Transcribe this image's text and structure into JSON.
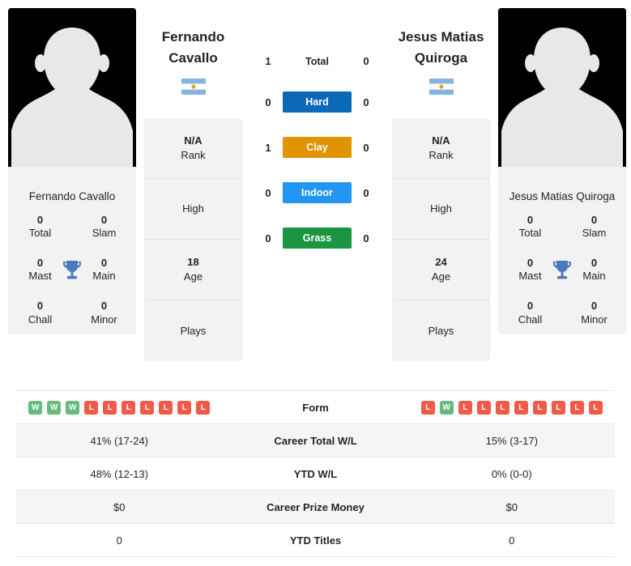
{
  "players": {
    "left": {
      "display_name_line1": "Fernando",
      "display_name_line2": "Cavallo",
      "full_name": "Fernando Cavallo",
      "flag": "argentina-flag",
      "avatar": "player-silhouette",
      "rank_value": "N/A",
      "rank_label": "Rank",
      "high_value": "",
      "high_label": "High",
      "age_value": "18",
      "age_label": "Age",
      "plays_value": "",
      "plays_label": "Plays",
      "titles": [
        {
          "value": "0",
          "label": "Total"
        },
        {
          "value": "0",
          "label": "Slam"
        },
        {
          "value": "0",
          "label": "Mast"
        },
        {
          "value": "0",
          "label": "Main"
        },
        {
          "value": "0",
          "label": "Chall"
        },
        {
          "value": "0",
          "label": "Minor"
        }
      ],
      "form": [
        "W",
        "W",
        "W",
        "L",
        "L",
        "L",
        "L",
        "L",
        "L",
        "L"
      ],
      "career_total_wl": "41% (17-24)",
      "ytd_wl": "48% (12-13)",
      "career_prize_money": "$0",
      "ytd_titles": "0"
    },
    "right": {
      "display_name_line1": "Jesus Matias",
      "display_name_line2": "Quiroga",
      "full_name": "Jesus Matias Quiroga",
      "flag": "argentina-flag",
      "avatar": "player-silhouette",
      "rank_value": "N/A",
      "rank_label": "Rank",
      "high_value": "",
      "high_label": "High",
      "age_value": "24",
      "age_label": "Age",
      "plays_value": "",
      "plays_label": "Plays",
      "titles": [
        {
          "value": "0",
          "label": "Total"
        },
        {
          "value": "0",
          "label": "Slam"
        },
        {
          "value": "0",
          "label": "Mast"
        },
        {
          "value": "0",
          "label": "Main"
        },
        {
          "value": "0",
          "label": "Chall"
        },
        {
          "value": "0",
          "label": "Minor"
        }
      ],
      "form": [
        "L",
        "W",
        "L",
        "L",
        "L",
        "L",
        "L",
        "L",
        "L",
        "L"
      ],
      "career_total_wl": "15% (3-17)",
      "ytd_wl": "0% (0-0)",
      "career_prize_money": "$0",
      "ytd_titles": "0"
    }
  },
  "head_to_head": [
    {
      "left": "1",
      "label": "Total",
      "right": "0",
      "style": "plain",
      "color": ""
    },
    {
      "left": "0",
      "label": "Hard",
      "right": "0",
      "style": "bar",
      "color": "#0b69b8"
    },
    {
      "left": "1",
      "label": "Clay",
      "right": "0",
      "style": "bar",
      "color": "#e09400"
    },
    {
      "left": "0",
      "label": "Indoor",
      "right": "0",
      "style": "bar",
      "color": "#2196f3"
    },
    {
      "left": "0",
      "label": "Grass",
      "right": "0",
      "style": "bar",
      "color": "#1a9641"
    }
  ],
  "table": {
    "rows": [
      {
        "label": "Form",
        "type": "form",
        "shade": false
      },
      {
        "label": "Career Total W/L",
        "type": "text",
        "shade": true,
        "left": "41% (17-24)",
        "right": "15% (3-17)"
      },
      {
        "label": "YTD W/L",
        "type": "text",
        "shade": false,
        "left": "48% (12-13)",
        "right": "0% (0-0)"
      },
      {
        "label": "Career Prize Money",
        "type": "text",
        "shade": true,
        "left": "$0",
        "right": "$0"
      },
      {
        "label": "YTD Titles",
        "type": "text",
        "shade": false,
        "left": "0",
        "right": "0"
      }
    ]
  },
  "colors": {
    "hard": "#0b69b8",
    "clay": "#e09400",
    "indoor": "#2196f3",
    "grass": "#1a9641",
    "win_badge": "#66bb7e",
    "loss_badge": "#ef5b47",
    "card_bg": "#f2f2f2"
  }
}
